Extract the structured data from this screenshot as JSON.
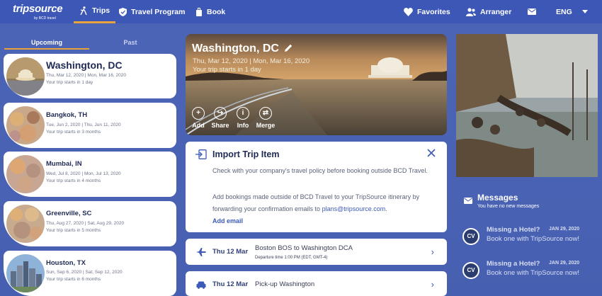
{
  "header": {
    "logo": "tripsource",
    "logo_sub": "by BCD travel",
    "nav": [
      {
        "label": "Trips",
        "icon": "trips-icon"
      },
      {
        "label": "Travel Program",
        "icon": "shield-icon"
      },
      {
        "label": "Book",
        "icon": "suitcase-icon"
      }
    ],
    "favorites": "Favorites",
    "arranger": "Arranger",
    "language": "ENG"
  },
  "tabs": {
    "upcoming": "Upcoming",
    "past": "Past"
  },
  "trips": [
    {
      "title": "Washington, DC",
      "dates": "Thu, Mar 12, 2020 | Mon, Mar 16, 2020",
      "status": "Your trip starts in 1 day"
    },
    {
      "title": "Bangkok, TH",
      "dates": "Tue, Jun 2, 2020 | Thu, Jun 11, 2020",
      "status": "Your trip starts in 3 months"
    },
    {
      "title": "Mumbai, IN",
      "dates": "Wed, Jul 8, 2020 | Mon, Jul 13, 2020",
      "status": "Your trip starts in 4 months"
    },
    {
      "title": "Greenville, SC",
      "dates": "Thu, Aug 27, 2020 | Sat, Aug 29, 2020",
      "status": "Your trip starts in 5 months"
    },
    {
      "title": "Houston, TX",
      "dates": "Sun, Sep 6, 2020 | Sat, Sep 12, 2020",
      "status": "Your trip starts in 6 months"
    }
  ],
  "hero": {
    "title": "Washington, DC",
    "dates": "Thu, Mar 12, 2020 | Mon, Mar 16, 2020",
    "status": "Your trip starts in 1 day",
    "actions": [
      {
        "label": "Add",
        "glyph": "+"
      },
      {
        "label": "Share",
        "glyph": "↪"
      },
      {
        "label": "Info",
        "glyph": "i"
      },
      {
        "label": "Merge",
        "glyph": "⇄"
      }
    ]
  },
  "import": {
    "title": "Import Trip Item",
    "para1": "Check with your company's travel policy before booking outside BCD Travel.",
    "para2_pre": "Add bookings made outside of BCD Travel to your TripSource itinerary by forwarding your confirmation emails to ",
    "email": "plans@tripsource.com",
    "para2_post": ".",
    "add_email": "Add email"
  },
  "segments": [
    {
      "date": "Thu 12 Mar",
      "title": "Boston BOS to Washington DCA",
      "sub": "Departure time 1:00 PM (EDT, GMT-4)",
      "icon": "airplane-icon"
    },
    {
      "date": "Thu 12 Mar",
      "title": "Pick-up Washington",
      "sub": "",
      "icon": "car-icon"
    }
  ],
  "messages": {
    "title": "Messages",
    "subtitle": "You have no new messages",
    "items": [
      {
        "avatar": "CV",
        "title": "Missing a Hotel?",
        "date": "JAN 29, 2020",
        "body": "Book one with TripSource now!"
      },
      {
        "avatar": "CV",
        "title": "Missing a Hotel?",
        "date": "JAN 29, 2020",
        "body": "Book one with TripSource now!"
      }
    ]
  },
  "colors": {
    "primary": "#4a62b3",
    "accent": "#e8a33d",
    "link": "#3d5ab8"
  }
}
